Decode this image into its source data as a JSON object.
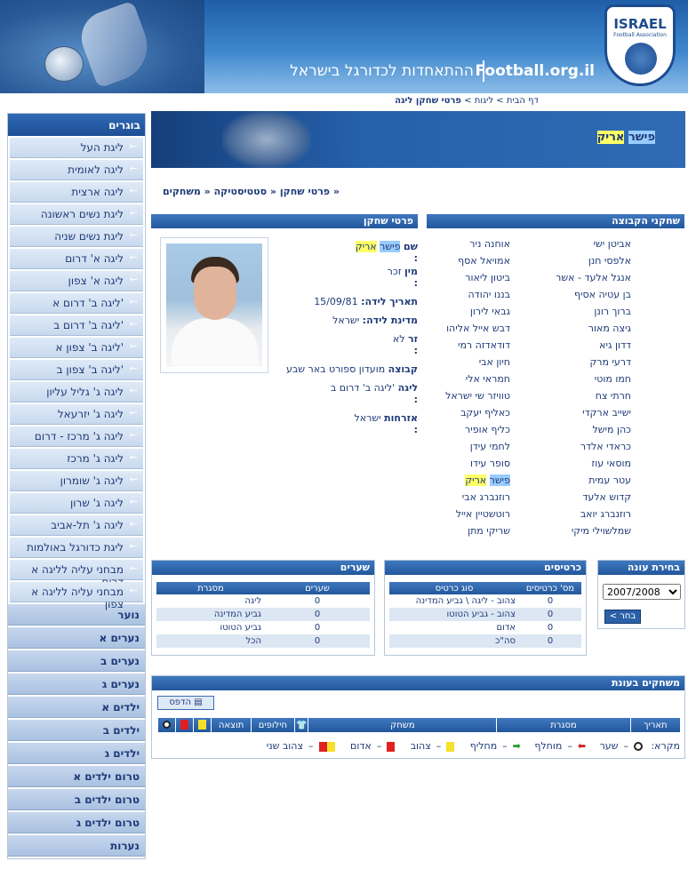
{
  "header": {
    "site_name_heb": "ההתאחדות לכדורגל בישראל",
    "site_domain": "Football.org.il",
    "logo_title": "ISRAEL",
    "logo_subtitle": "Football Association"
  },
  "breadcrumb": {
    "home": "דף הבית",
    "sep1": " > ",
    "leagues": "ליגות",
    "sep2": " > ",
    "current": "פרטי שחקן ליגה"
  },
  "sidebar": {
    "header": "בוגרים",
    "sub_items": [
      "ליגת העל",
      "ליגה לאומית",
      "ליגה ארצית",
      "ליגת נשים ראשונה",
      "ליגת נשים שניה",
      "ליגה א' דרום",
      "ליגה א' צפון",
      "'ליגה ב' דרום א",
      "'ליגה ב' דרום ב",
      "'ליגה ב' צפון א",
      "'ליגה ב' צפון ב",
      "ליגה ג' גליל עליון",
      "ליגה ג' יזרעאל",
      "ליגה ג' מרכז - דרום",
      "ליגה ג' מרכז",
      "ליגה ג' שומרון",
      "ליגה ג' שרון",
      "ליגה ג' תל-אביב",
      "ליגת כדורגל באולמות",
      "מבחני עליה לליגה א דרום",
      "מבחני עליה לליגה א צפון"
    ],
    "top_items": [
      "נוער",
      "נערים א",
      "נערים ב",
      "נערים ג",
      "ילדים א",
      "ילדים ב",
      "ילדים ג",
      "טרום ילדים א",
      "טרום ילדים ב",
      "טרום ילדים ג",
      "נערות"
    ]
  },
  "player": {
    "last_name": "פישר",
    "first_name": "אריק"
  },
  "tabs": {
    "details": "פרטי שחקן",
    "stats": "סטטיסטיקה",
    "games": "משחקים"
  },
  "details": {
    "title": "פרטי שחקן",
    "name_label": "שם",
    "gender_label": "מין",
    "gender_value": "זכר",
    "dob_label": "תאריך לידה",
    "dob_value": "15/09/81",
    "birth_country_label": "מדינת לידה",
    "birth_country_value": "ישראל",
    "foreign_label": "זר",
    "foreign_value": "לא",
    "team_label": "קבוצה",
    "team_value": "מועדון ספורט באר שבע",
    "league_label": "ליגה",
    "league_value": "'ליגה ב' דרום ב",
    "citizenship_label": "אזרחות",
    "citizenship_value": "ישראל",
    "colon": ":"
  },
  "team": {
    "title": "שחקני הקבוצה",
    "column_right": [
      "אביטן ישי",
      "אלפסי חנן",
      "אנגל אלעד - אשר",
      "בן עטיה אסיף",
      "ברוך רונן",
      "גיצה מאור",
      "דדון גיא",
      "דרעי מרק",
      "חמו מוטי",
      "חרתי צח",
      "ישייב ארקדי",
      "כהן מישל",
      "כראדי אלדר",
      "מוסאי עוז",
      "עטר עמית",
      "קדוש אלעד",
      "רוזנברג יואב",
      "שמלשוילי מיקי"
    ],
    "column_left": [
      "אוחנה ניר",
      "אמויאל אסף",
      "ביטון ליאור",
      "בננו יהודה",
      "גבאי לירון",
      "דבש אייל אליהו",
      "דודאדזה רמי",
      "חיון אבי",
      "חמראי אלי",
      "טוויזר שי ישראל",
      "כאליף יעקב",
      "כליף אופיר",
      "לחמי עידן",
      "סופר עידו",
      "פישר אריק",
      "רוזנברג אבי",
      "רוטשטיין אייל",
      "שריקי מתן"
    ],
    "current_last": "פישר",
    "current_first": "אריק"
  },
  "season": {
    "title": "בחירת עונה",
    "selected": "2007/2008",
    "button": "בחר >"
  },
  "cards": {
    "title": "כרטיסים",
    "headers": [
      "סוג כרטיס",
      "מס' כרטיסים"
    ],
    "rows": [
      [
        "צהוב - ליגה \\ גביע המדינה",
        "0"
      ],
      [
        "צהוב - גביע הטוטו",
        "0"
      ],
      [
        "אדום",
        "0"
      ],
      [
        "סה\"כ",
        "0"
      ]
    ]
  },
  "goals": {
    "title": "שערים",
    "headers": [
      "מסגרת",
      "שערים"
    ],
    "rows": [
      [
        "ליגה",
        "0"
      ],
      [
        "גביע המדינה",
        "0"
      ],
      [
        "גביע הטוטו",
        "0"
      ],
      [
        "הכל",
        "0"
      ]
    ]
  },
  "games": {
    "title": "משחקים בעונת",
    "print_button": "הדפס",
    "headers": [
      "תאריך",
      "מסגרת",
      "משחק",
      "חילופים",
      "תוצאה"
    ],
    "legend": {
      "label": "מקרא:",
      "goal": "שער",
      "sub_out": "מוחלף",
      "sub_in": "מחליף",
      "yellow": "צהוב",
      "red": "אדום",
      "second_yellow": "צהוב שני",
      "dash": "–"
    }
  }
}
